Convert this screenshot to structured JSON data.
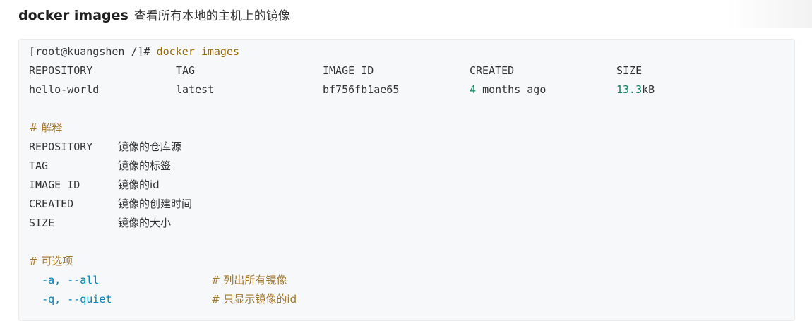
{
  "heading": {
    "command": "docker images",
    "description": "查看所有本地的主机上的镜像"
  },
  "prompt": "[root@kuangshen /]#",
  "command": "docker images",
  "table": {
    "headers": [
      "REPOSITORY",
      "TAG",
      "IMAGE ID",
      "CREATED",
      "SIZE"
    ],
    "row": {
      "repository": "hello-world",
      "tag": "latest",
      "image_id": "bf756fb1ae65",
      "created_num": "4",
      "created_rest": "months ago",
      "size_num": "13.3",
      "size_unit": "kB"
    }
  },
  "explain": {
    "comment": "# 解释",
    "items": [
      {
        "key": "REPOSITORY",
        "value": "镜像的仓库源"
      },
      {
        "key": "TAG",
        "value": "镜像的标签"
      },
      {
        "key": "IMAGE ID",
        "value": "镜像的id"
      },
      {
        "key": "CREATED",
        "value": "镜像的创建时间"
      },
      {
        "key": "SIZE",
        "value": "镜像的大小"
      }
    ]
  },
  "options": {
    "comment": "# 可选项",
    "items": [
      {
        "flag": "-a, --all",
        "comment": "# 列出所有镜像"
      },
      {
        "flag": "-q, --quiet",
        "comment": "# 只显示镜像的id"
      }
    ]
  }
}
